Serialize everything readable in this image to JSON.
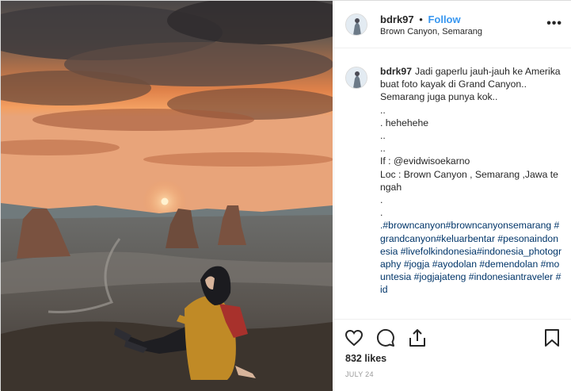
{
  "post": {
    "username": "bdrk97",
    "separator": "•",
    "follow_label": "Follow",
    "location": "Brown Canyon, Semarang",
    "more_label": "•••"
  },
  "caption": {
    "username": "bdrk97",
    "lines": [
      "Jadi gaperlu jauh-jauh ke Amerika buat foto kayak di Grand Canyon..",
      "Semarang juga punya kok..",
      "..",
      ". hehehehe",
      "..",
      "..",
      "If : @evidwisoekarno",
      "Loc : Brown Canyon , Semarang ,Jawa tengah",
      ".",
      "."
    ],
    "hashtags": ".#browncanyon#browncanyonsemarang #grandcanyon#keluarbentar #pesonaindonesia #livefolkindonesia#indonesia_photography #jogja #ayodolan #demendolan #mountesia #jogjajateng #indonesiantraveler #id"
  },
  "actions": {
    "likes": "832 likes",
    "date": "JULY 24"
  },
  "icons": {
    "heart": "heart-icon",
    "comment": "comment-icon",
    "share": "share-icon",
    "save": "bookmark-icon",
    "more": "more-options-icon"
  }
}
